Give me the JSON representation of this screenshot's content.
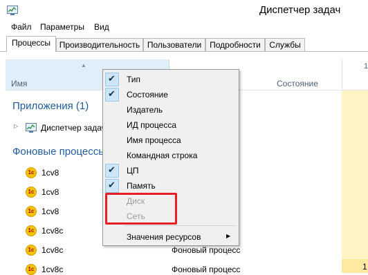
{
  "window": {
    "title": "Диспетчер задач",
    "icon": "task-manager-icon"
  },
  "menu": {
    "items": [
      "Файл",
      "Параметры",
      "Вид"
    ]
  },
  "tabs": [
    {
      "label": "Процессы",
      "active": true
    },
    {
      "label": "Производительность",
      "active": false
    },
    {
      "label": "Пользователи",
      "active": false
    },
    {
      "label": "Подробности",
      "active": false
    },
    {
      "label": "Службы",
      "active": false
    }
  ],
  "table": {
    "columns": {
      "name": "Имя",
      "status": "Состояние",
      "cpu": "1"
    },
    "groups": {
      "apps": {
        "title": "Приложения (1)",
        "items": [
          {
            "name": "Диспетчер задач"
          }
        ]
      },
      "background": {
        "title": "Фоновые процессы",
        "items": [
          {
            "name": "1cv8",
            "status": ""
          },
          {
            "name": "1cv8",
            "status": ""
          },
          {
            "name": "1cv8",
            "status": ""
          },
          {
            "name": "1cv8c",
            "status": ""
          },
          {
            "name": "1cv8c",
            "status": "Фоновый процесс"
          },
          {
            "name": "1cv8c",
            "status": "Фоновый процесс"
          }
        ]
      }
    },
    "cpu_last_value": "1"
  },
  "context_menu": {
    "items": [
      {
        "label": "Тип",
        "checked": true,
        "disabled": false
      },
      {
        "label": "Состояние",
        "checked": true,
        "disabled": false
      },
      {
        "label": "Издатель",
        "checked": false,
        "disabled": false
      },
      {
        "label": "ИД процесса",
        "checked": false,
        "disabled": false
      },
      {
        "label": "Имя процесса",
        "checked": false,
        "disabled": false
      },
      {
        "label": "Командная строка",
        "checked": false,
        "disabled": false
      },
      {
        "label": "ЦП",
        "checked": true,
        "disabled": false
      },
      {
        "label": "Память",
        "checked": true,
        "disabled": false
      },
      {
        "label": "Диск",
        "checked": false,
        "disabled": true
      },
      {
        "label": "Сеть",
        "checked": false,
        "disabled": true
      }
    ],
    "submenu": {
      "label": "Значения ресурсов"
    }
  },
  "badge_text": "1c",
  "colors": {
    "highlight": "#e52025",
    "group_title": "#1f5c99",
    "cpu_column": "#fff4c4"
  }
}
